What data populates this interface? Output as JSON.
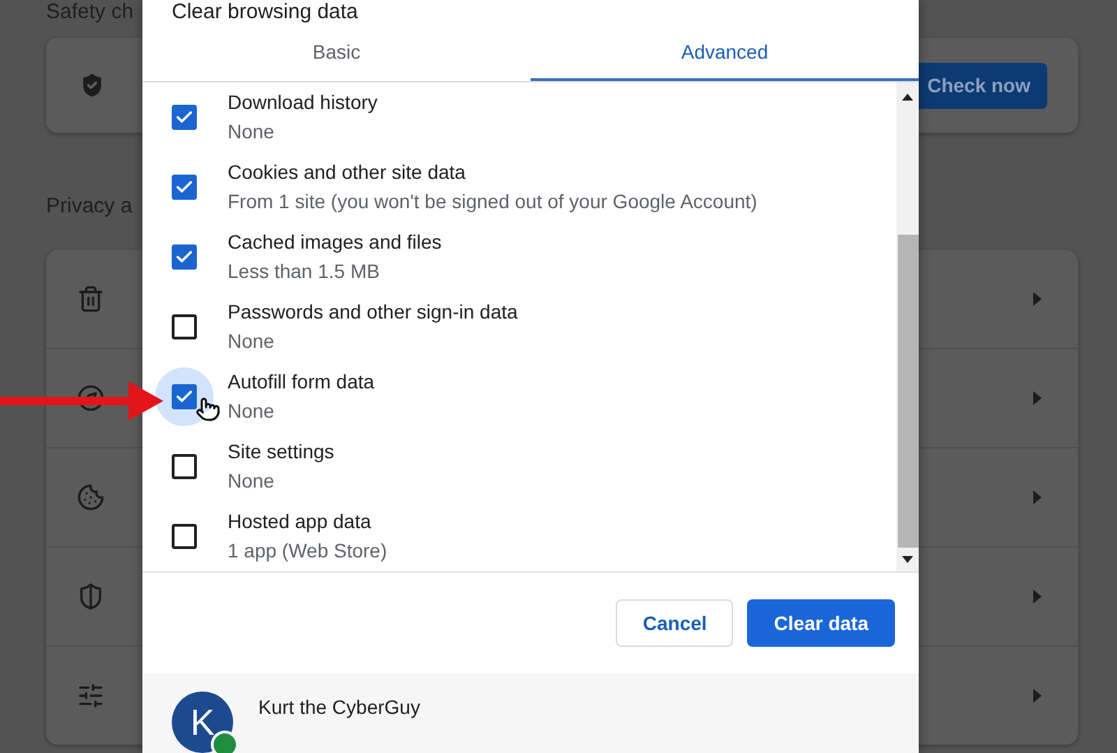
{
  "background": {
    "safety_heading": "Safety ch",
    "safety_card": {
      "button": "Check now"
    },
    "privacy_heading": "Privacy a",
    "rows": [
      {
        "kind": "trash"
      },
      {
        "kind": "compass"
      },
      {
        "kind": "cookie"
      },
      {
        "kind": "shield"
      },
      {
        "kind": "sliders"
      }
    ]
  },
  "dialog": {
    "title": "Clear browsing data",
    "tabs": [
      {
        "label": "Basic",
        "selected": false
      },
      {
        "label": "Advanced",
        "selected": true
      }
    ],
    "items": [
      {
        "title": "Download history",
        "detail": "None",
        "checked": true,
        "hovered": false
      },
      {
        "title": "Cookies and other site data",
        "detail": "From 1 site (you won't be signed out of your Google Account)",
        "checked": true,
        "hovered": false
      },
      {
        "title": "Cached images and files",
        "detail": "Less than 1.5 MB",
        "checked": true,
        "hovered": false
      },
      {
        "title": "Passwords and other sign-in data",
        "detail": "None",
        "checked": false,
        "hovered": false
      },
      {
        "title": "Autofill form data",
        "detail": "None",
        "checked": true,
        "hovered": true
      },
      {
        "title": "Site settings",
        "detail": "None",
        "checked": false,
        "hovered": false
      },
      {
        "title": "Hosted app data",
        "detail": "1 app (Web Store)",
        "checked": false,
        "hovered": false
      }
    ],
    "buttons": [
      {
        "label": "Cancel",
        "kind": "secondary"
      },
      {
        "label": "Clear data",
        "kind": "primary"
      }
    ],
    "account": {
      "initial": "K",
      "name": "Kurt the CyberGuy"
    }
  }
}
